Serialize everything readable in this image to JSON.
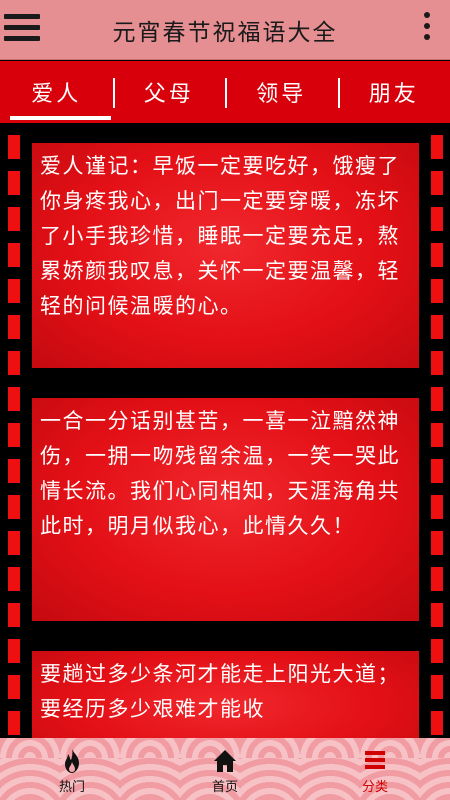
{
  "header": {
    "title": "元宵春节祝福语大全",
    "menu_icon": "menu-icon",
    "more_icon": "more-vertical-icon"
  },
  "tabs": [
    {
      "label": "爱人",
      "active": true
    },
    {
      "label": "父母",
      "active": false
    },
    {
      "label": "领导",
      "active": false
    },
    {
      "label": "朋友",
      "active": false
    }
  ],
  "cards": [
    {
      "text": "爱人谨记：早饭一定要吃好，饿瘦了你身疼我心，出门一定要穿暖，冻坏了小手我珍惜，睡眠一定要充足，熬累娇颜我叹息，关怀一定要温馨，轻轻的问候温暖的心。"
    },
    {
      "text": "一合一分话别甚苦，一喜一泣黯然神伤，一拥一吻残留余温，一笑一哭此情长流。我们心同相知，天涯海角共此时，明月似我心，此情久久！"
    },
    {
      "text": "要趟过多少条河才能走上阳光大道；要经历多少艰难才能收"
    }
  ],
  "bottom_nav": [
    {
      "label": "热门",
      "icon": "fire-icon",
      "active": false
    },
    {
      "label": "首页",
      "icon": "home-icon",
      "active": false
    },
    {
      "label": "分类",
      "icon": "list-icon",
      "active": true
    }
  ],
  "colors": {
    "topbar": "#e68f92",
    "tabs": "#d8000b",
    "card": "#e31016",
    "active_nav": "#d00000"
  }
}
